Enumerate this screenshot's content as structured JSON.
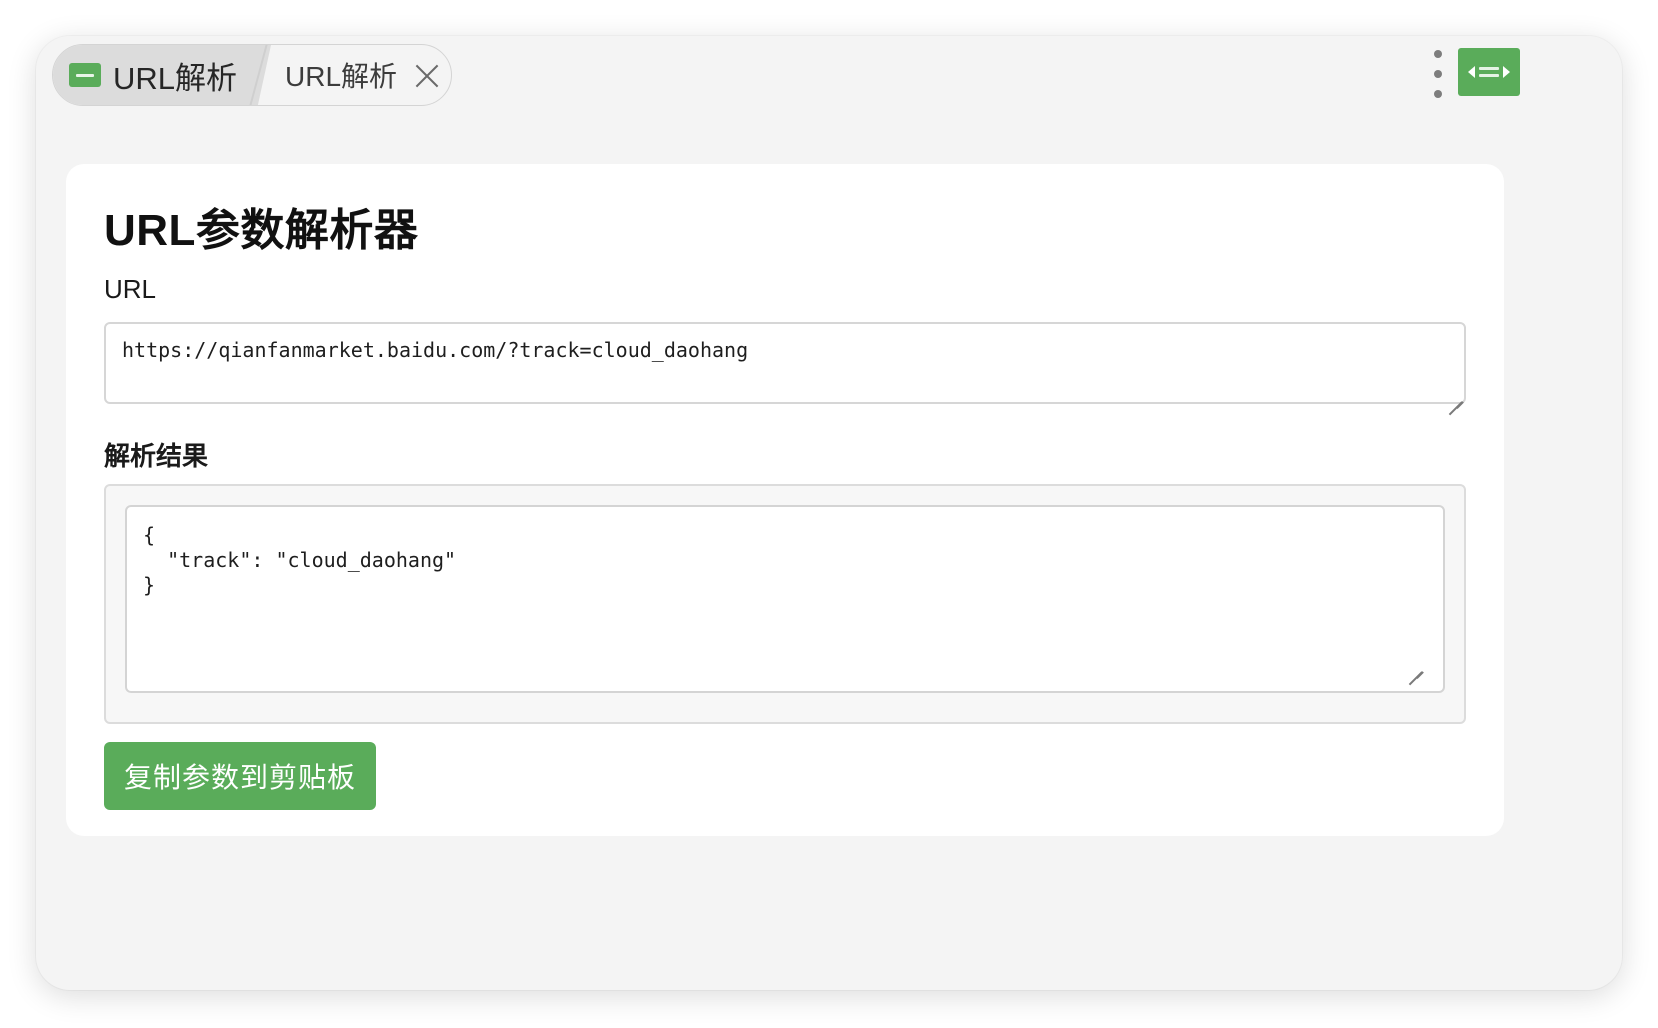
{
  "tabs": [
    {
      "label": "URL解析",
      "active": true,
      "icon": "link-parse-icon"
    },
    {
      "label": "URL解析",
      "active": false
    }
  ],
  "toolbar": {
    "more_icon": "kebab-menu-icon",
    "extension_icon": "link-parse-icon"
  },
  "main": {
    "title": "URL参数解析器",
    "url_label": "URL",
    "url_value": "https://qianfanmarket.baidu.com/?track=cloud_daohang",
    "result_label": "解析结果",
    "result_value": "{\n  \"track\": \"cloud_daohang\"\n}",
    "copy_button_label": "复制参数到剪贴板"
  },
  "colors": {
    "accent": "#5aac5a",
    "window_bg": "#f4f4f4",
    "card_bg": "#ffffff"
  }
}
